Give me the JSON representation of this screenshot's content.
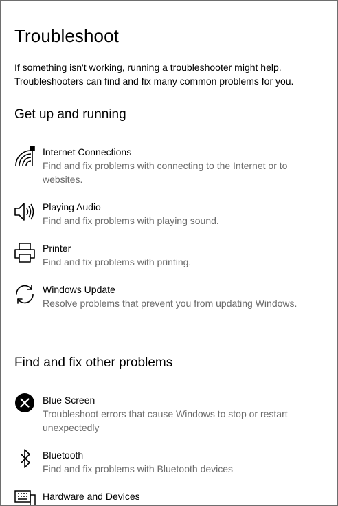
{
  "page": {
    "title": "Troubleshoot",
    "description": "If something isn't working, running a troubleshooter might help. Troubleshooters can find and fix many common problems for you."
  },
  "sections": [
    {
      "heading": "Get up and running",
      "items": [
        {
          "name": "Internet Connections",
          "desc": "Find and fix problems with connecting to the Internet or to websites.",
          "icon": "network-icon"
        },
        {
          "name": "Playing Audio",
          "desc": "Find and fix problems with playing sound.",
          "icon": "speaker-icon"
        },
        {
          "name": "Printer",
          "desc": "Find and fix problems with printing.",
          "icon": "printer-icon"
        },
        {
          "name": "Windows Update",
          "desc": "Resolve problems that prevent you from updating Windows.",
          "icon": "sync-icon"
        }
      ]
    },
    {
      "heading": "Find and fix other problems",
      "items": [
        {
          "name": "Blue Screen",
          "desc": "Troubleshoot errors that cause Windows to stop or restart unexpectedly",
          "icon": "error-x-icon"
        },
        {
          "name": "Bluetooth",
          "desc": "Find and fix problems with Bluetooth devices",
          "icon": "bluetooth-icon"
        },
        {
          "name": "Hardware and Devices",
          "desc": "",
          "icon": "keyboard-device-icon"
        }
      ]
    }
  ]
}
